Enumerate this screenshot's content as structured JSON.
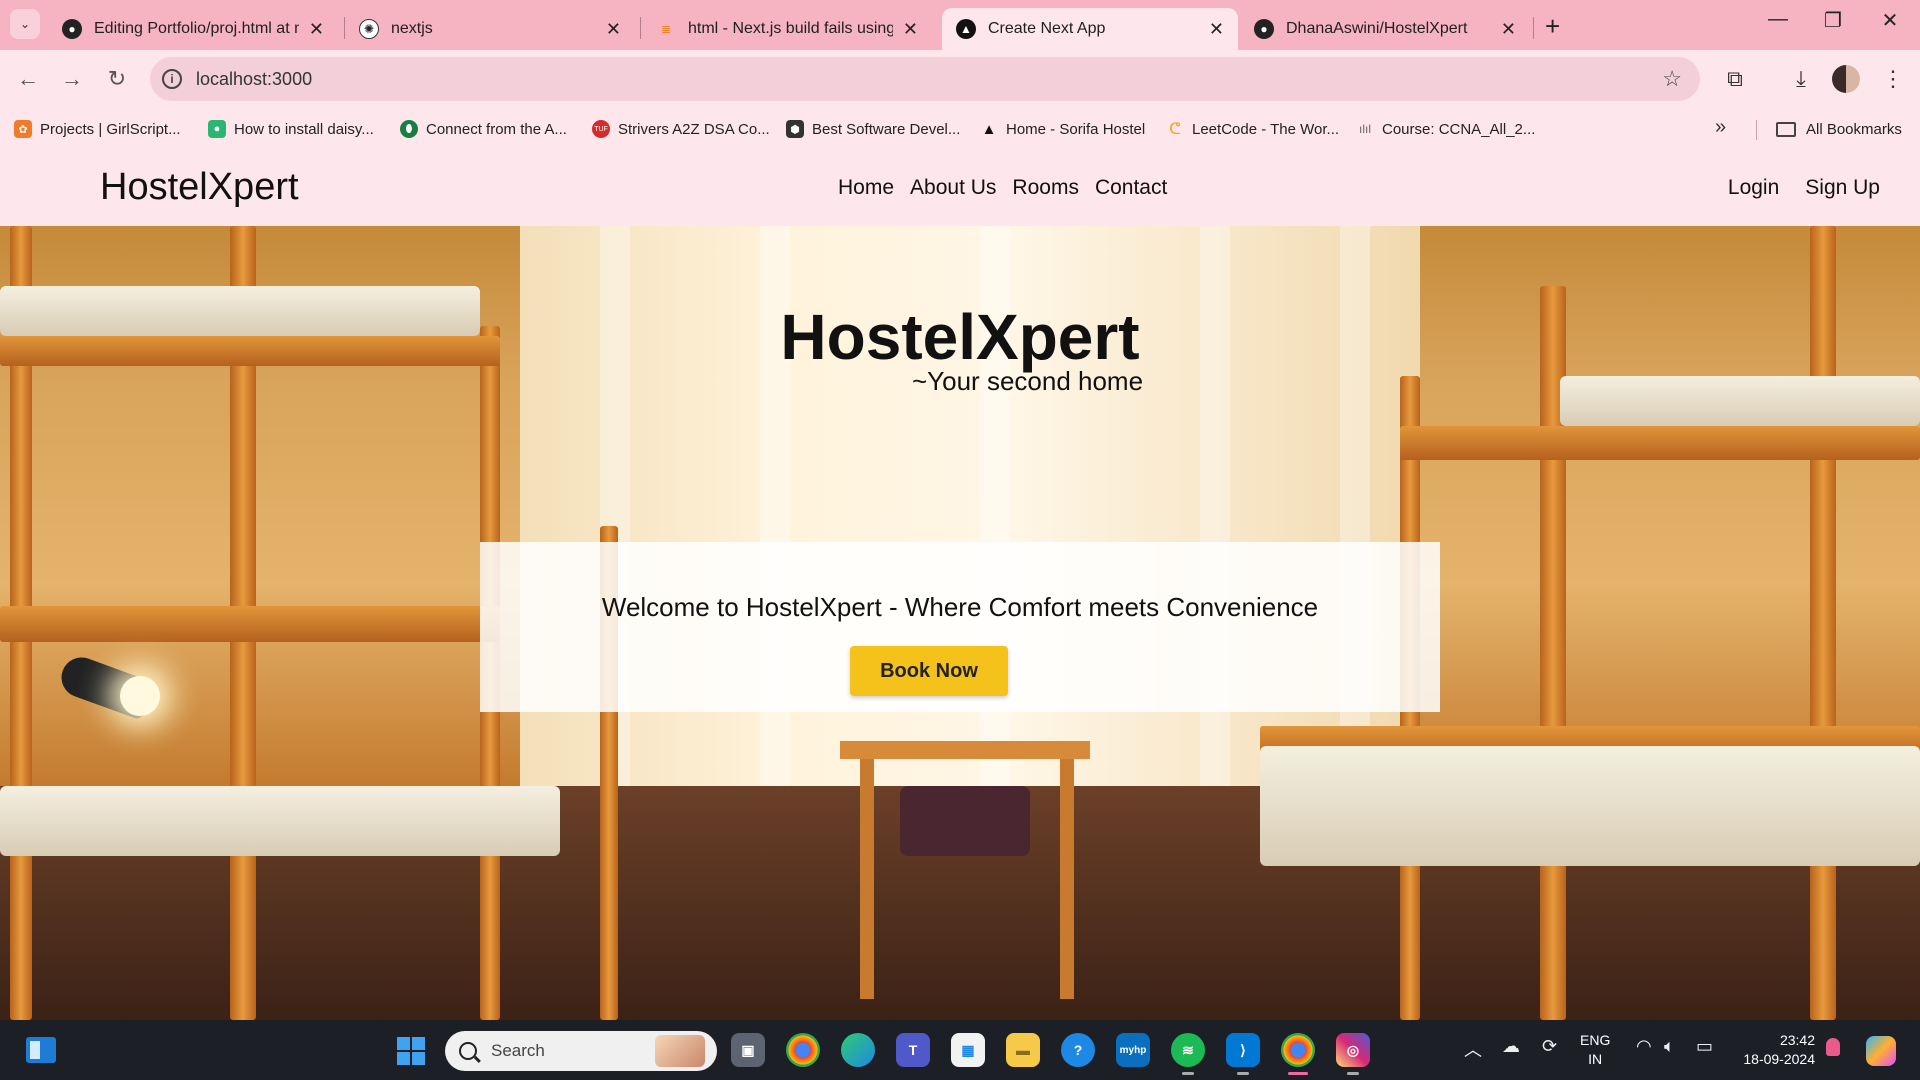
{
  "browser": {
    "tabs": [
      {
        "title": "Editing Portfolio/proj.html at m",
        "icon": "github-icon",
        "active": false
      },
      {
        "title": "nextjs",
        "icon": "chatgpt-icon",
        "active": false
      },
      {
        "title": "html - Next.js build fails using",
        "icon": "stackoverflow-icon",
        "active": false
      },
      {
        "title": "Create Next App",
        "icon": "nextjs-icon",
        "active": true
      },
      {
        "title": "DhanaAswini/HostelXpert",
        "icon": "github-icon",
        "active": false
      }
    ],
    "url": "localhost:3000",
    "bookmarks": [
      {
        "label": "Projects | GirlScript...",
        "icon": "girlscript-icon",
        "color": "#f07b2a"
      },
      {
        "label": "How to install daisy...",
        "icon": "daisyui-icon",
        "color": "#2bb673"
      },
      {
        "label": "Connect from the A...",
        "icon": "mongodb-icon",
        "color": "#1a7d43"
      },
      {
        "label": "Strivers A2Z DSA Co...",
        "icon": "tuf-icon",
        "color": "#d62b2b"
      },
      {
        "label": "Best Software Devel...",
        "icon": "shield-icon",
        "color": "#333333"
      },
      {
        "label": "Home - Sorifa Hostel",
        "icon": "triangle-icon",
        "color": "#111111"
      },
      {
        "label": "LeetCode - The Wor...",
        "icon": "leetcode-icon",
        "color": "#ffa116"
      },
      {
        "label": "Course: CCNA_All_2...",
        "icon": "cisco-icon",
        "color": "#666666"
      }
    ],
    "all_bookmarks_label": "All Bookmarks"
  },
  "site": {
    "brand": "HostelXpert",
    "nav": {
      "home": "Home",
      "about": "About Us",
      "rooms": "Rooms",
      "contact": "Contact"
    },
    "auth": {
      "login": "Login",
      "signup": "Sign Up"
    },
    "hero": {
      "title": "HostelXpert",
      "tagline": "~Your second home",
      "welcome": "Welcome to HostelXpert - Where Comfort meets Convenience",
      "cta": "Book Now"
    }
  },
  "taskbar": {
    "search_placeholder": "Search",
    "lang_line1": "ENG",
    "lang_line2": "IN",
    "time": "23:42",
    "date": "18-09-2024"
  },
  "colors": {
    "tab_strip": "#f6b3c1",
    "toolbar": "#fde6ec",
    "site_nav": "#fde6ec",
    "cta": "#f4c21a",
    "taskbar": "#1c1f26"
  }
}
